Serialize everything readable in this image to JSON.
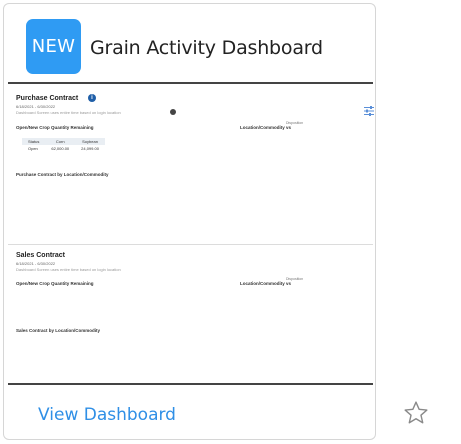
{
  "card": {
    "badge": "NEW",
    "title": "Grain Activity Dashboard",
    "view_link": "View Dashboard",
    "favorite_icon": "star-outline-icon"
  },
  "preview": {
    "purchase": {
      "title": "Purchase Contract",
      "date_range": "6/18/2021 - 6/30/2022",
      "filter_line": "Dashboard Screen uses entire time based on login location",
      "section_label": "Open/New Crop Quantity Remaining",
      "location_label": "Location/Commodity vs",
      "location_sup": "Disposition",
      "table": {
        "headers": [
          "Status",
          "Corn",
          "Soybean"
        ],
        "rows": [
          [
            "Open",
            "62,000.00",
            "24,099.00"
          ]
        ]
      },
      "by_location": "Purchase Contract by Location/Commodity"
    },
    "sales": {
      "title": "Sales Contract",
      "date_range": "6/18/2021 - 6/30/2022",
      "filter_line": "Dashboard Screen uses entire time based on login location",
      "section_label": "Open/New Crop Quantity Remaining",
      "location_label": "Location/Commodity vs",
      "location_sup": "Disposition",
      "by_location": "Sales Contract by Location/Commodity"
    },
    "icons": {
      "info": "info-icon",
      "tag": "tag-icon",
      "filter": "filter-sliders-icon"
    },
    "colors": {
      "badge": "#2f9bf3",
      "link": "#2f8fe6",
      "info": "#1f5fa8"
    }
  }
}
